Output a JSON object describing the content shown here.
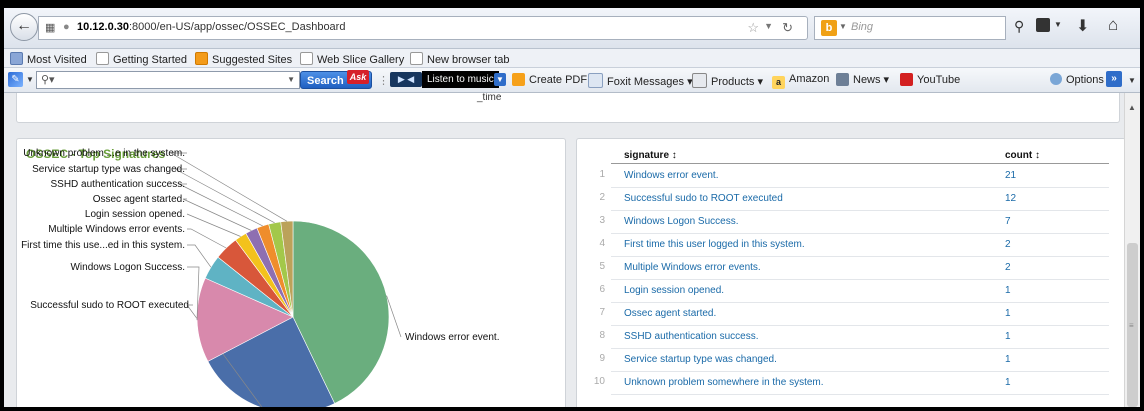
{
  "browser": {
    "url_prefix": "10.12.0.30",
    "url_rest": ":8000/en-US/app/ossec/OSSEC_Dashboard",
    "search_engine_placeholder": "Bing",
    "bookmarks": [
      "Most Visited",
      "Getting Started",
      "Suggested Sites",
      "Web Slice Gallery",
      "New browser tab"
    ],
    "toolbar": {
      "search_button": "Search",
      "ask_logo": "Ask",
      "listen_label": "Listen to music",
      "items": [
        "Create PDF",
        "Foxit Messages ▾",
        "Products ▾",
        "Amazon",
        "News ▾",
        "YouTube"
      ],
      "options_label": "Options ▾",
      "more_label": "»"
    }
  },
  "dashboard": {
    "top_panel_axis_label": "_time",
    "left_panel": {
      "title": "OSSEC - Top Signatures"
    },
    "right_panel": {
      "columns": [
        "signature ↕",
        "count ↕"
      ],
      "rows": [
        {
          "n": "1",
          "signature": "Windows error event.",
          "count": "21"
        },
        {
          "n": "2",
          "signature": "Successful sudo to ROOT executed",
          "count": "12"
        },
        {
          "n": "3",
          "signature": "Windows Logon Success.",
          "count": "7"
        },
        {
          "n": "4",
          "signature": "First time this user logged in this system.",
          "count": "2"
        },
        {
          "n": "5",
          "signature": "Multiple Windows error events.",
          "count": "2"
        },
        {
          "n": "6",
          "signature": "Login session opened.",
          "count": "1"
        },
        {
          "n": "7",
          "signature": "Ossec agent started.",
          "count": "1"
        },
        {
          "n": "8",
          "signature": "SSHD authentication success.",
          "count": "1"
        },
        {
          "n": "9",
          "signature": "Service startup type was changed.",
          "count": "1"
        },
        {
          "n": "10",
          "signature": "Unknown problem somewhere in the system.",
          "count": "1"
        }
      ]
    }
  },
  "chart_data": {
    "type": "pie",
    "title": "OSSEC - Top Signatures",
    "categories": [
      "Windows error event.",
      "Successful sudo to ROOT executed",
      "Windows Logon Success.",
      "First time this use...ed in this system.",
      "Multiple Windows error events.",
      "Login session opened.",
      "Ossec agent started.",
      "SSHD authentication success.",
      "Service startup type was changed.",
      "Unknown problem ...e in the system."
    ],
    "values": [
      21,
      12,
      7,
      2,
      2,
      1,
      1,
      1,
      1,
      1
    ],
    "colors": [
      "#6aae7e",
      "#4a6ea9",
      "#d889ac",
      "#5fb3c4",
      "#d8573a",
      "#f3c21c",
      "#8e6fb1",
      "#ef8d2c",
      "#a3c84a",
      "#bba25a"
    ]
  }
}
